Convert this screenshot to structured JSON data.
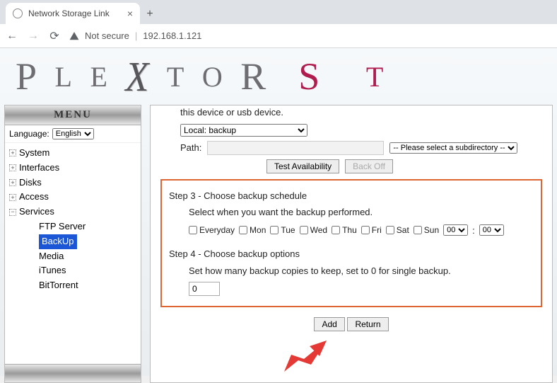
{
  "browser": {
    "tab_title": "Network Storage Link",
    "not_secure": "Not secure",
    "url": "192.168.1.121"
  },
  "brand": {
    "p": "P",
    "l": "L",
    "e": "E",
    "x": "X",
    "t": "T",
    "o": "O",
    "r": "R",
    "s": "S",
    "t2": "T"
  },
  "sidebar": {
    "menu_label": "MENU",
    "language_label": "Language:",
    "language_value": "English",
    "items": [
      "System",
      "Interfaces",
      "Disks",
      "Access",
      "Services"
    ],
    "services": [
      "FTP Server",
      "BackUp",
      "Media",
      "iTunes",
      "BitTorrent"
    ]
  },
  "content": {
    "top_text": "this device or usb device.",
    "source_select": "Local: backup",
    "path_label": "Path:",
    "subdir_placeholder": "-- Please select a subdirectory --",
    "test_btn": "Test Availability",
    "backoff_btn": "Back Off",
    "step3_title": "Step 3 - Choose backup schedule",
    "step3_desc": "Select when you want the backup performed.",
    "days": [
      "Everyday",
      "Mon",
      "Tue",
      "Wed",
      "Thu",
      "Fri",
      "Sat",
      "Sun"
    ],
    "hour": "00",
    "minute": "00",
    "time_sep": ":",
    "step4_title": "Step 4 - Choose backup options",
    "step4_desc": "Set how many backup copies to keep, set to 0 for single backup.",
    "copies": "0",
    "add_btn": "Add",
    "return_btn": "Return"
  }
}
